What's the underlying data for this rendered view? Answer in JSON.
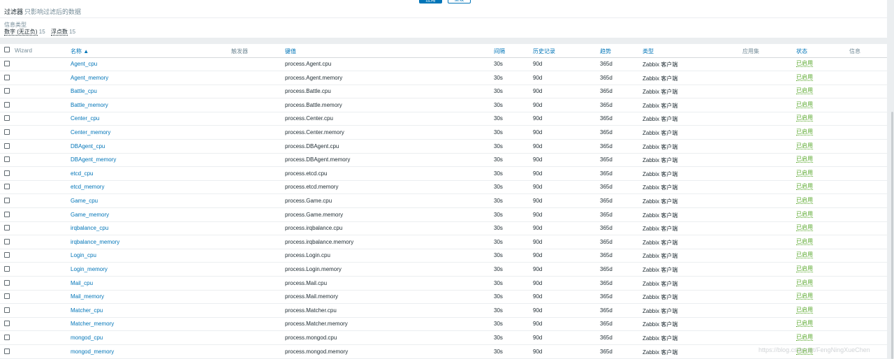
{
  "filter": {
    "apply_label": "应用",
    "reset_label": "重设",
    "title": "过滤器",
    "subtitle": "只影响过滤后的数据",
    "info_type_label": "信息类型",
    "types": [
      {
        "label": "数字 (无正负)",
        "count": "15"
      },
      {
        "label": "浮点数",
        "count": "15"
      }
    ]
  },
  "table": {
    "columns": {
      "wizard": "Wizard",
      "name": "名称 ▲",
      "triggers": "触发器",
      "key": "键值",
      "interval": "间隔",
      "history": "历史记录",
      "trends": "趋势",
      "type": "类型",
      "applications": "应用集",
      "status": "状态",
      "info": "信息"
    },
    "rows": [
      {
        "name": "Agent_cpu",
        "key": "process.Agent.cpu",
        "interval": "30s",
        "history": "90d",
        "trends": "365d",
        "type": "Zabbix 客户端",
        "status": "已启用"
      },
      {
        "name": "Agent_memory",
        "key": "process.Agent.memory",
        "interval": "30s",
        "history": "90d",
        "trends": "365d",
        "type": "Zabbix 客户端",
        "status": "已启用"
      },
      {
        "name": "Battle_cpu",
        "key": "process.Battle.cpu",
        "interval": "30s",
        "history": "90d",
        "trends": "365d",
        "type": "Zabbix 客户端",
        "status": "已启用"
      },
      {
        "name": "Battle_memory",
        "key": "process.Battle.memory",
        "interval": "30s",
        "history": "90d",
        "trends": "365d",
        "type": "Zabbix 客户端",
        "status": "已启用"
      },
      {
        "name": "Center_cpu",
        "key": "process.Center.cpu",
        "interval": "30s",
        "history": "90d",
        "trends": "365d",
        "type": "Zabbix 客户端",
        "status": "已启用"
      },
      {
        "name": "Center_memory",
        "key": "process.Center.memory",
        "interval": "30s",
        "history": "90d",
        "trends": "365d",
        "type": "Zabbix 客户端",
        "status": "已启用"
      },
      {
        "name": "DBAgent_cpu",
        "key": "process.DBAgent.cpu",
        "interval": "30s",
        "history": "90d",
        "trends": "365d",
        "type": "Zabbix 客户端",
        "status": "已启用"
      },
      {
        "name": "DBAgent_memory",
        "key": "process.DBAgent.memory",
        "interval": "30s",
        "history": "90d",
        "trends": "365d",
        "type": "Zabbix 客户端",
        "status": "已启用"
      },
      {
        "name": "etcd_cpu",
        "key": "process.etcd.cpu",
        "interval": "30s",
        "history": "90d",
        "trends": "365d",
        "type": "Zabbix 客户端",
        "status": "已启用"
      },
      {
        "name": "etcd_memory",
        "key": "process.etcd.memory",
        "interval": "30s",
        "history": "90d",
        "trends": "365d",
        "type": "Zabbix 客户端",
        "status": "已启用"
      },
      {
        "name": "Game_cpu",
        "key": "process.Game.cpu",
        "interval": "30s",
        "history": "90d",
        "trends": "365d",
        "type": "Zabbix 客户端",
        "status": "已启用"
      },
      {
        "name": "Game_memory",
        "key": "process.Game.memory",
        "interval": "30s",
        "history": "90d",
        "trends": "365d",
        "type": "Zabbix 客户端",
        "status": "已启用"
      },
      {
        "name": "irqbalance_cpu",
        "key": "process.irqbalance.cpu",
        "interval": "30s",
        "history": "90d",
        "trends": "365d",
        "type": "Zabbix 客户端",
        "status": "已启用"
      },
      {
        "name": "irqbalance_memory",
        "key": "process.irqbalance.memory",
        "interval": "30s",
        "history": "90d",
        "trends": "365d",
        "type": "Zabbix 客户端",
        "status": "已启用"
      },
      {
        "name": "Login_cpu",
        "key": "process.Login.cpu",
        "interval": "30s",
        "history": "90d",
        "trends": "365d",
        "type": "Zabbix 客户端",
        "status": "已启用"
      },
      {
        "name": "Login_memory",
        "key": "process.Login.memory",
        "interval": "30s",
        "history": "90d",
        "trends": "365d",
        "type": "Zabbix 客户端",
        "status": "已启用"
      },
      {
        "name": "Mail_cpu",
        "key": "process.Mail.cpu",
        "interval": "30s",
        "history": "90d",
        "trends": "365d",
        "type": "Zabbix 客户端",
        "status": "已启用"
      },
      {
        "name": "Mail_memory",
        "key": "process.Mail.memory",
        "interval": "30s",
        "history": "90d",
        "trends": "365d",
        "type": "Zabbix 客户端",
        "status": "已启用"
      },
      {
        "name": "Matcher_cpu",
        "key": "process.Matcher.cpu",
        "interval": "30s",
        "history": "90d",
        "trends": "365d",
        "type": "Zabbix 客户端",
        "status": "已启用"
      },
      {
        "name": "Matcher_memory",
        "key": "process.Matcher.memory",
        "interval": "30s",
        "history": "90d",
        "trends": "365d",
        "type": "Zabbix 客户端",
        "status": "已启用"
      },
      {
        "name": "mongod_cpu",
        "key": "process.mongod.cpu",
        "interval": "30s",
        "history": "90d",
        "trends": "365d",
        "type": "Zabbix 客户端",
        "status": "已启用"
      },
      {
        "name": "mongod_memory",
        "key": "process.mongod.memory",
        "interval": "30s",
        "history": "90d",
        "trends": "365d",
        "type": "Zabbix 客户端",
        "status": "已启用"
      }
    ]
  },
  "watermark": "https://blog.csdn.net/FengNingXueChen"
}
